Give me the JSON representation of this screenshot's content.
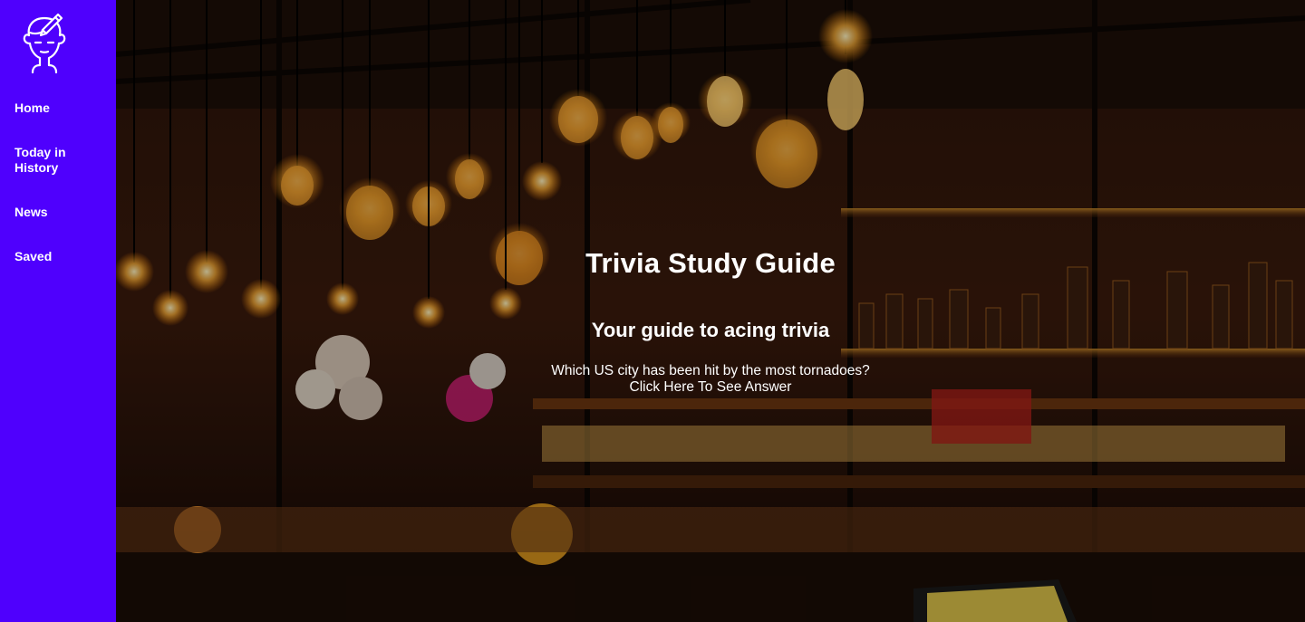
{
  "sidebar": {
    "background": "#4f00fd",
    "logo_icon": "head-with-pencil-icon",
    "items": [
      {
        "label": "Home"
      },
      {
        "label": "Today in\nHistory"
      },
      {
        "label": "News"
      },
      {
        "label": "Saved"
      }
    ]
  },
  "hero": {
    "background_image": "bar-with-edison-bulbs-photo",
    "title": "Trivia Study Guide",
    "subtitle": "Your guide to acing trivia",
    "question": "Which US city has been hit by the most tornadoes?",
    "answer_link": "Click Here To See Answer"
  }
}
